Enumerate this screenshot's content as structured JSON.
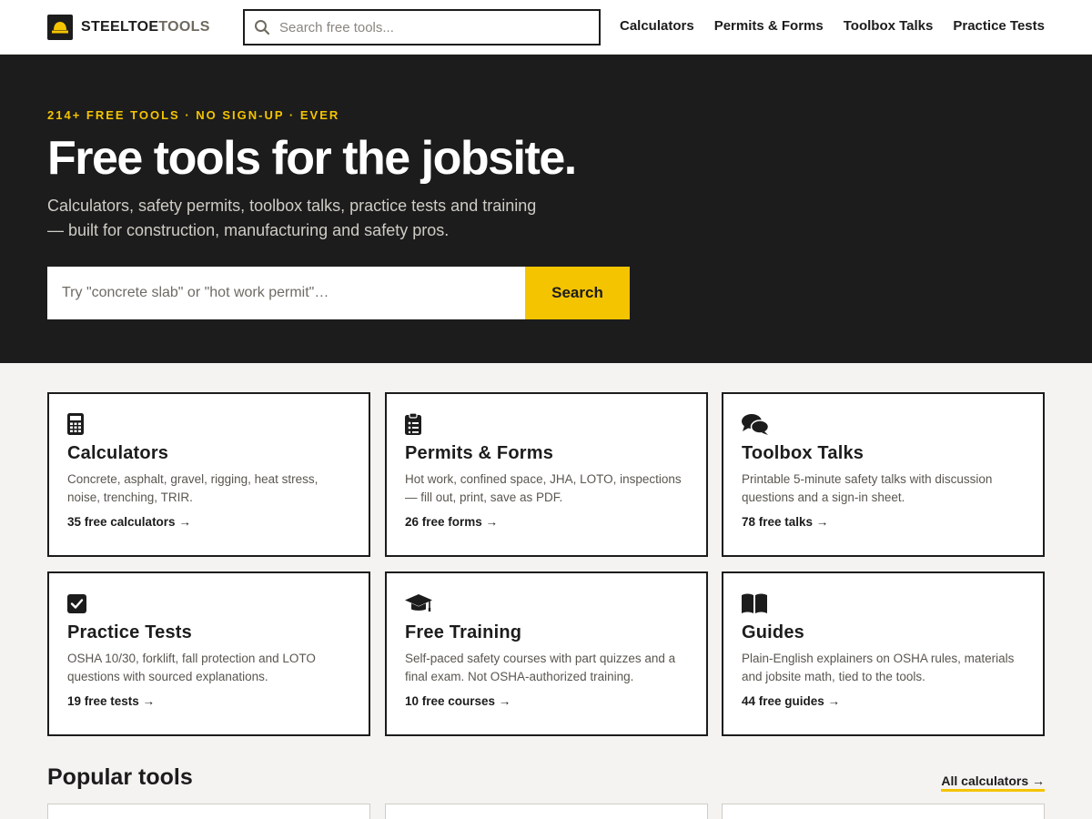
{
  "brand": {
    "part1": "STEELTOE",
    "part2": "TOOLS"
  },
  "header": {
    "search_placeholder": "Search free tools...",
    "nav": [
      "Calculators",
      "Permits & Forms",
      "Toolbox Talks",
      "Practice Tests"
    ]
  },
  "hero": {
    "eyebrow": "214+ FREE TOOLS · NO SIGN-UP · EVER",
    "title": "Free tools for the jobsite.",
    "subtitle": "Calculators, safety permits, toolbox talks, practice tests and training — built for construction, manufacturing and safety pros.",
    "search_placeholder": "Try \"concrete slab\" or \"hot work permit\"…",
    "search_button": "Search"
  },
  "cards": [
    {
      "icon": "calculator-icon",
      "title": "Calculators",
      "desc": "Concrete, asphalt, gravel, rigging, heat stress, noise, trenching, TRIR.",
      "link": "35 free calculators →"
    },
    {
      "icon": "clipboard-icon",
      "title": "Permits & Forms",
      "desc": "Hot work, confined space, JHA, LOTO, inspections — fill out, print, save as PDF.",
      "link": "26 free forms →"
    },
    {
      "icon": "comments-icon",
      "title": "Toolbox Talks",
      "desc": "Printable 5-minute safety talks with discussion questions and a sign-in sheet.",
      "link": "78 free talks →"
    },
    {
      "icon": "checkbox-icon",
      "title": "Practice Tests",
      "desc": "OSHA 10/30, forklift, fall protection and LOTO questions with sourced explanations.",
      "link": "19 free tests →"
    },
    {
      "icon": "graduation-cap-icon",
      "title": "Free Training",
      "desc": "Self-paced safety courses with part quizzes and a final exam. Not OSHA-authorized training.",
      "link": "10 free courses →"
    },
    {
      "icon": "book-icon",
      "title": "Guides",
      "desc": "Plain-English explainers on OSHA rules, materials and jobsite math, tied to the tools.",
      "link": "44 free guides →"
    }
  ],
  "popular": {
    "title": "Popular tools",
    "link": "All calculators →"
  },
  "colors": {
    "accent": "#f5c400",
    "dark": "#1c1c1c",
    "background": "#f4f3f1"
  }
}
